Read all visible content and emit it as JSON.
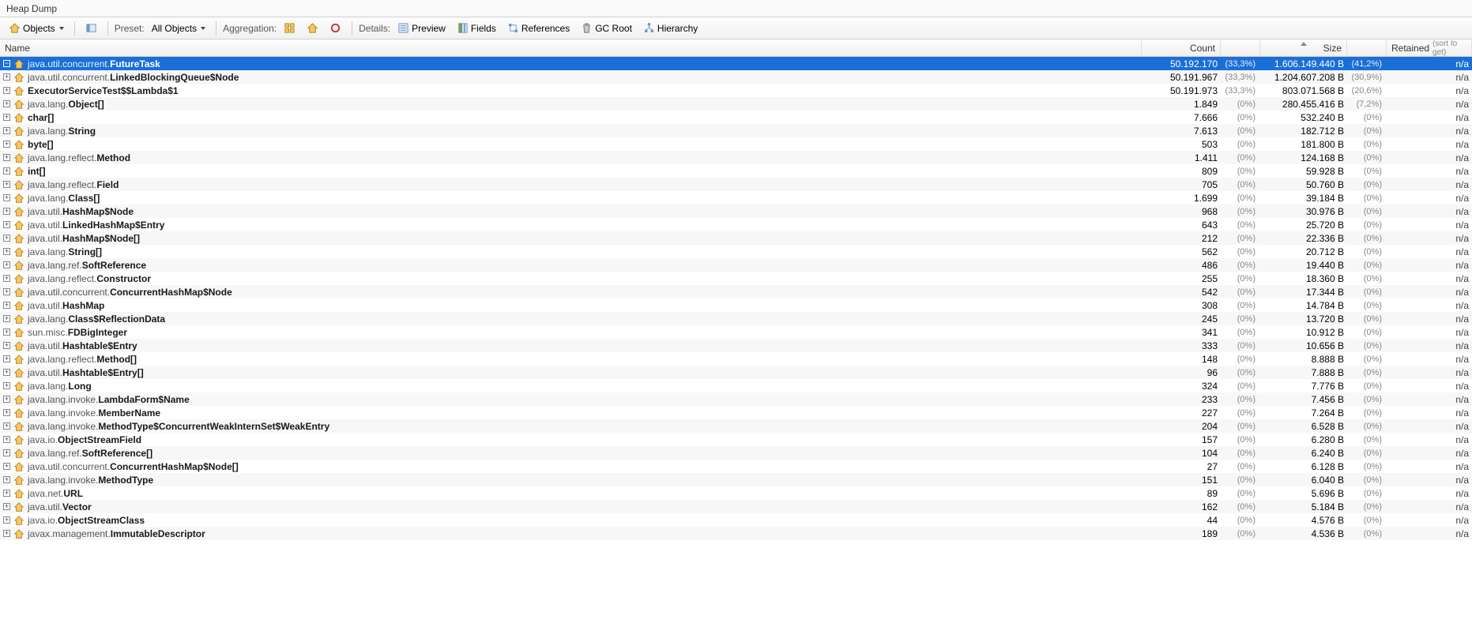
{
  "title": "Heap Dump",
  "toolbar": {
    "objects": "Objects",
    "preset": "Preset:",
    "preset_value": "All Objects",
    "aggregation": "Aggregation:",
    "details": "Details:",
    "preview": "Preview",
    "fields": "Fields",
    "references": "References",
    "gcroot": "GC Root",
    "hierarchy": "Hierarchy"
  },
  "headers": {
    "name": "Name",
    "count": "Count",
    "size": "Size",
    "retained": "Retained",
    "sorthint": "(sort to get)"
  },
  "rows": [
    {
      "pkg": "java.util.concurrent.",
      "cls": "FutureTask",
      "count": "50.192.170",
      "cpct": "(33,3%)",
      "size": "1.606.149.440 B",
      "spct": "(41,2%)",
      "ret": "n/a",
      "sel": true
    },
    {
      "pkg": "java.util.concurrent.",
      "cls": "LinkedBlockingQueue$Node",
      "count": "50.191.967",
      "cpct": "(33,3%)",
      "size": "1.204.607.208 B",
      "spct": "(30,9%)",
      "ret": "n/a"
    },
    {
      "pkg": "",
      "cls": "ExecutorServiceTest$$Lambda$1",
      "count": "50.191.973",
      "cpct": "(33,3%)",
      "size": "803.071.568 B",
      "spct": "(20,6%)",
      "ret": "n/a"
    },
    {
      "pkg": "java.lang.",
      "cls": "Object[]",
      "count": "1.849",
      "cpct": "(0%)",
      "size": "280.455.416 B",
      "spct": "(7,2%)",
      "ret": "n/a"
    },
    {
      "pkg": "",
      "cls": "char[]",
      "count": "7.666",
      "cpct": "(0%)",
      "size": "532.240 B",
      "spct": "(0%)",
      "ret": "n/a"
    },
    {
      "pkg": "java.lang.",
      "cls": "String",
      "count": "7.613",
      "cpct": "(0%)",
      "size": "182.712 B",
      "spct": "(0%)",
      "ret": "n/a"
    },
    {
      "pkg": "",
      "cls": "byte[]",
      "count": "503",
      "cpct": "(0%)",
      "size": "181.800 B",
      "spct": "(0%)",
      "ret": "n/a"
    },
    {
      "pkg": "java.lang.reflect.",
      "cls": "Method",
      "count": "1.411",
      "cpct": "(0%)",
      "size": "124.168 B",
      "spct": "(0%)",
      "ret": "n/a"
    },
    {
      "pkg": "",
      "cls": "int[]",
      "count": "809",
      "cpct": "(0%)",
      "size": "59.928 B",
      "spct": "(0%)",
      "ret": "n/a"
    },
    {
      "pkg": "java.lang.reflect.",
      "cls": "Field",
      "count": "705",
      "cpct": "(0%)",
      "size": "50.760 B",
      "spct": "(0%)",
      "ret": "n/a"
    },
    {
      "pkg": "java.lang.",
      "cls": "Class[]",
      "count": "1.699",
      "cpct": "(0%)",
      "size": "39.184 B",
      "spct": "(0%)",
      "ret": "n/a"
    },
    {
      "pkg": "java.util.",
      "cls": "HashMap$Node",
      "count": "968",
      "cpct": "(0%)",
      "size": "30.976 B",
      "spct": "(0%)",
      "ret": "n/a"
    },
    {
      "pkg": "java.util.",
      "cls": "LinkedHashMap$Entry",
      "count": "643",
      "cpct": "(0%)",
      "size": "25.720 B",
      "spct": "(0%)",
      "ret": "n/a"
    },
    {
      "pkg": "java.util.",
      "cls": "HashMap$Node[]",
      "count": "212",
      "cpct": "(0%)",
      "size": "22.336 B",
      "spct": "(0%)",
      "ret": "n/a"
    },
    {
      "pkg": "java.lang.",
      "cls": "String[]",
      "count": "562",
      "cpct": "(0%)",
      "size": "20.712 B",
      "spct": "(0%)",
      "ret": "n/a"
    },
    {
      "pkg": "java.lang.ref.",
      "cls": "SoftReference",
      "count": "486",
      "cpct": "(0%)",
      "size": "19.440 B",
      "spct": "(0%)",
      "ret": "n/a"
    },
    {
      "pkg": "java.lang.reflect.",
      "cls": "Constructor",
      "count": "255",
      "cpct": "(0%)",
      "size": "18.360 B",
      "spct": "(0%)",
      "ret": "n/a"
    },
    {
      "pkg": "java.util.concurrent.",
      "cls": "ConcurrentHashMap$Node",
      "count": "542",
      "cpct": "(0%)",
      "size": "17.344 B",
      "spct": "(0%)",
      "ret": "n/a"
    },
    {
      "pkg": "java.util.",
      "cls": "HashMap",
      "count": "308",
      "cpct": "(0%)",
      "size": "14.784 B",
      "spct": "(0%)",
      "ret": "n/a"
    },
    {
      "pkg": "java.lang.",
      "cls": "Class$ReflectionData",
      "count": "245",
      "cpct": "(0%)",
      "size": "13.720 B",
      "spct": "(0%)",
      "ret": "n/a"
    },
    {
      "pkg": "sun.misc.",
      "cls": "FDBigInteger",
      "count": "341",
      "cpct": "(0%)",
      "size": "10.912 B",
      "spct": "(0%)",
      "ret": "n/a"
    },
    {
      "pkg": "java.util.",
      "cls": "Hashtable$Entry",
      "count": "333",
      "cpct": "(0%)",
      "size": "10.656 B",
      "spct": "(0%)",
      "ret": "n/a"
    },
    {
      "pkg": "java.lang.reflect.",
      "cls": "Method[]",
      "count": "148",
      "cpct": "(0%)",
      "size": "8.888 B",
      "spct": "(0%)",
      "ret": "n/a"
    },
    {
      "pkg": "java.util.",
      "cls": "Hashtable$Entry[]",
      "count": "96",
      "cpct": "(0%)",
      "size": "7.888 B",
      "spct": "(0%)",
      "ret": "n/a"
    },
    {
      "pkg": "java.lang.",
      "cls": "Long",
      "count": "324",
      "cpct": "(0%)",
      "size": "7.776 B",
      "spct": "(0%)",
      "ret": "n/a"
    },
    {
      "pkg": "java.lang.invoke.",
      "cls": "LambdaForm$Name",
      "count": "233",
      "cpct": "(0%)",
      "size": "7.456 B",
      "spct": "(0%)",
      "ret": "n/a"
    },
    {
      "pkg": "java.lang.invoke.",
      "cls": "MemberName",
      "count": "227",
      "cpct": "(0%)",
      "size": "7.264 B",
      "spct": "(0%)",
      "ret": "n/a"
    },
    {
      "pkg": "java.lang.invoke.",
      "cls": "MethodType$ConcurrentWeakInternSet$WeakEntry",
      "count": "204",
      "cpct": "(0%)",
      "size": "6.528 B",
      "spct": "(0%)",
      "ret": "n/a"
    },
    {
      "pkg": "java.io.",
      "cls": "ObjectStreamField",
      "count": "157",
      "cpct": "(0%)",
      "size": "6.280 B",
      "spct": "(0%)",
      "ret": "n/a"
    },
    {
      "pkg": "java.lang.ref.",
      "cls": "SoftReference[]",
      "count": "104",
      "cpct": "(0%)",
      "size": "6.240 B",
      "spct": "(0%)",
      "ret": "n/a"
    },
    {
      "pkg": "java.util.concurrent.",
      "cls": "ConcurrentHashMap$Node[]",
      "count": "27",
      "cpct": "(0%)",
      "size": "6.128 B",
      "spct": "(0%)",
      "ret": "n/a"
    },
    {
      "pkg": "java.lang.invoke.",
      "cls": "MethodType",
      "count": "151",
      "cpct": "(0%)",
      "size": "6.040 B",
      "spct": "(0%)",
      "ret": "n/a"
    },
    {
      "pkg": "java.net.",
      "cls": "URL",
      "count": "89",
      "cpct": "(0%)",
      "size": "5.696 B",
      "spct": "(0%)",
      "ret": "n/a"
    },
    {
      "pkg": "java.util.",
      "cls": "Vector",
      "count": "162",
      "cpct": "(0%)",
      "size": "5.184 B",
      "spct": "(0%)",
      "ret": "n/a"
    },
    {
      "pkg": "java.io.",
      "cls": "ObjectStreamClass",
      "count": "44",
      "cpct": "(0%)",
      "size": "4.576 B",
      "spct": "(0%)",
      "ret": "n/a"
    },
    {
      "pkg": "javax.management.",
      "cls": "ImmutableDescriptor",
      "count": "189",
      "cpct": "(0%)",
      "size": "4.536 B",
      "spct": "(0%)",
      "ret": "n/a"
    }
  ]
}
